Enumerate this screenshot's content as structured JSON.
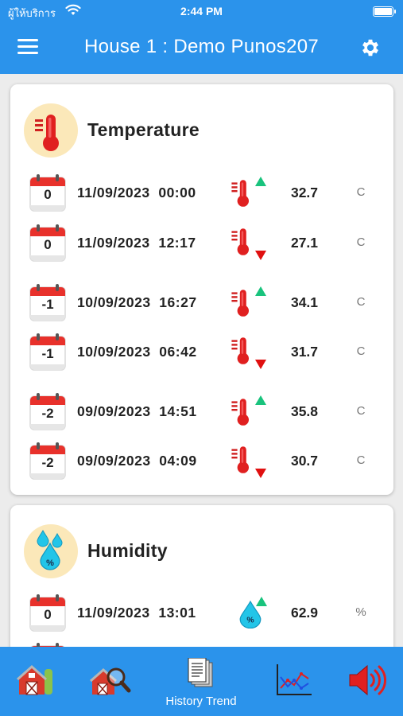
{
  "status_bar": {
    "carrier": "ผู้ให้บริการ",
    "time": "2:44 PM"
  },
  "header": {
    "title": "House 1 : Demo Punos207"
  },
  "temperature": {
    "title": "Temperature",
    "rows": [
      {
        "day": "0",
        "datetime": "11/09/2023  00:00",
        "trend": "up",
        "value": "32.7",
        "unit": "C"
      },
      {
        "day": "0",
        "datetime": "11/09/2023  12:17",
        "trend": "down",
        "value": "27.1",
        "unit": "C"
      },
      {
        "day": "-1",
        "datetime": "10/09/2023  16:27",
        "trend": "up",
        "value": "34.1",
        "unit": "C"
      },
      {
        "day": "-1",
        "datetime": "10/09/2023  06:42",
        "trend": "down",
        "value": "31.7",
        "unit": "C"
      },
      {
        "day": "-2",
        "datetime": "09/09/2023  14:51",
        "trend": "up",
        "value": "35.8",
        "unit": "C"
      },
      {
        "day": "-2",
        "datetime": "09/09/2023  04:09",
        "trend": "down",
        "value": "30.7",
        "unit": "C"
      }
    ]
  },
  "humidity": {
    "title": "Humidity",
    "rows": [
      {
        "day": "0",
        "datetime": "11/09/2023  13:01",
        "trend": "up",
        "value": "62.9",
        "unit": "%"
      }
    ]
  },
  "bottom_nav": {
    "items": [
      {
        "icon": "barn-icon"
      },
      {
        "icon": "barn-search-icon"
      },
      {
        "icon": "history-documents-icon",
        "label": "History Trend"
      },
      {
        "icon": "line-chart-icon"
      },
      {
        "icon": "speaker-icon"
      }
    ]
  },
  "colors": {
    "primary": "#2b93eb",
    "trend_up": "#19c37d",
    "trend_down": "#e01010",
    "thermometer": "#e02020",
    "calendar_red": "#e8312b"
  }
}
